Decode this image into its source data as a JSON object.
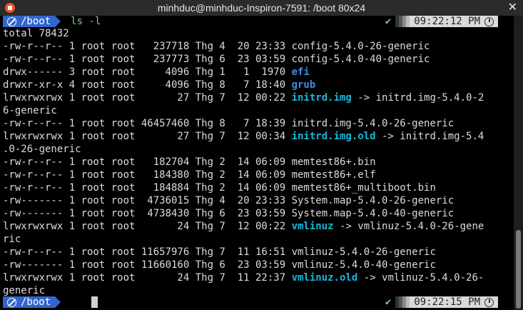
{
  "window": {
    "title": "minhduc@minhduc-Inspiron-7591: /boot 80x24",
    "close_glyph": "✕"
  },
  "prompt1": {
    "path": "/boot",
    "command": "ls -l",
    "check": "✔",
    "time": "09:22:12 PM"
  },
  "prompt2": {
    "path": "/boot",
    "check": "✔",
    "time": "09:22:15 PM"
  },
  "lines": [
    "total 78432",
    "-rw-r--r-- 1 root root   237718 Thg 4  20 23:33 config-5.4.0-26-generic",
    "-rw-r--r-- 1 root root   237773 Thg 6  23 03:59 config-5.4.0-40-generic",
    "drwx------ 3 root root     4096 Thg 1   1  1970 ",
    "drwxr-xr-x 4 root root     4096 Thg 8   7 18:40 ",
    "lrwxrwxrwx 1 root root       27 Thg 7  12 00:22 ",
    "6-generic",
    "-rw-r--r-- 1 root root 46457460 Thg 8   7 18:39 initrd.img-5.4.0-26-generic",
    "lrwxrwxrwx 1 root root       27 Thg 7  12 00:34 ",
    ".0-26-generic",
    "-rw-r--r-- 1 root root   182704 Thg 2  14 06:09 memtest86+.bin",
    "-rw-r--r-- 1 root root   184380 Thg 2  14 06:09 memtest86+.elf",
    "-rw-r--r-- 1 root root   184884 Thg 2  14 06:09 memtest86+_multiboot.bin",
    "-rw------- 1 root root  4736015 Thg 4  20 23:33 System.map-5.4.0-26-generic",
    "-rw------- 1 root root  4738430 Thg 6  23 03:59 System.map-5.4.0-40-generic",
    "lrwxrwxrwx 1 root root       24 Thg 7  12 00:22 ",
    "ric",
    "-rw-r--r-- 1 root root 11657976 Thg 7  11 16:51 vmlinuz-5.4.0-26-generic",
    "-rw------- 1 root root 11660160 Thg 6  23 03:59 vmlinuz-5.4.0-40-generic",
    "lrwxrwxrwx 1 root root       24 Thg 7  11 22:37 ",
    "generic"
  ],
  "colored": {
    "efi": "efi",
    "grub": "grub",
    "initrd": "initrd.img",
    "initrd_target": " -> initrd.img-5.4.0-2",
    "initrd_old": "initrd.img.old",
    "initrd_old_target": " -> initrd.img-5.4",
    "vmlinuz": "vmlinuz",
    "vmlinuz_target": " -> vmlinuz-5.4.0-26-gene",
    "vmlinuz_old": "vmlinuz.old",
    "vmlinuz_old_target": " -> vmlinuz-5.4.0-26-"
  },
  "colors": {
    "dir": "#3b8edb",
    "symlink": "#18b8d8",
    "prompt_bg": "#3366cc",
    "ok": "#7fd07f"
  }
}
